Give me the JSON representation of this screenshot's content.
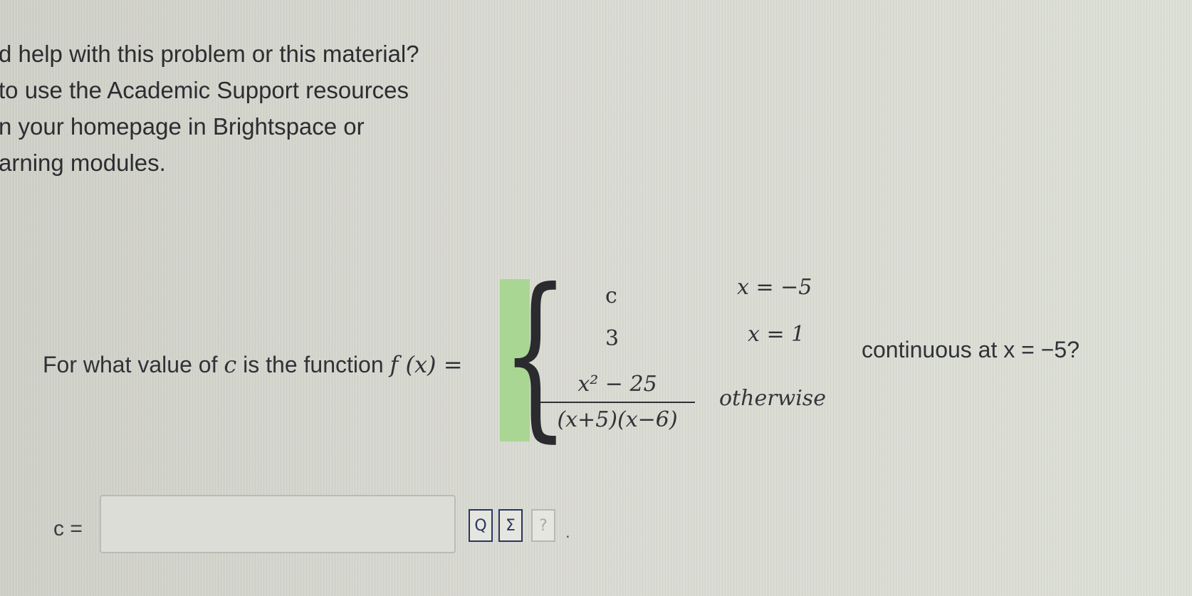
{
  "help_text": {
    "lines": [
      "d help with this problem or this material?",
      "to use the Academic Support resources",
      "n your homepage in Brightspace or",
      "arning modules."
    ]
  },
  "question": {
    "prefix": "For what value of",
    "variable": "c",
    "middle": "is the function",
    "function_name": "f (x) =",
    "cases": [
      {
        "value": "c",
        "condition": "x = −5"
      },
      {
        "value": "3",
        "condition": "x = 1"
      },
      {
        "numerator": "x² − 25",
        "denominator": "(x+5)(x−6)",
        "condition": "otherwise"
      }
    ],
    "suffix": "continuous at x = −5?"
  },
  "answer": {
    "label": "c =",
    "value": "",
    "placeholder": ""
  },
  "tools": {
    "preview_icon": "Q",
    "sigma_icon": "Σ",
    "help_icon": "?"
  }
}
